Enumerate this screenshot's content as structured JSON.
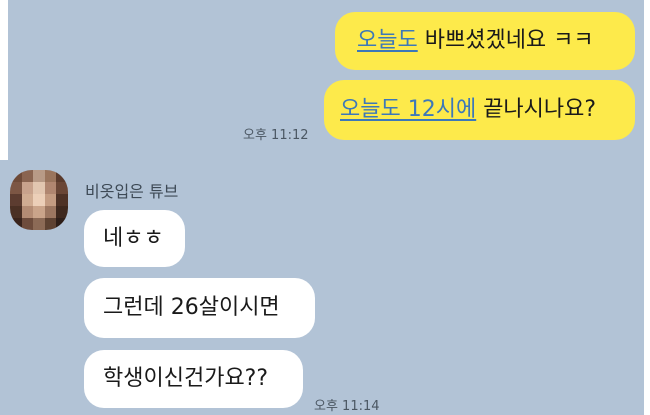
{
  "chat": {
    "sent": [
      {
        "link": "오늘도",
        "text": " 바쁘셨겠네요 ㅋㅋ"
      },
      {
        "link": "오늘도 12시에",
        "text": " 끝나시나요?"
      }
    ],
    "sent_time": "오후 11:12",
    "sender_name": "비옷입은 튜브",
    "received": [
      "네ㅎㅎ",
      "그런데 26살이시면",
      "학생이신건가요??"
    ],
    "received_time": "오후 11:14"
  },
  "colors": {
    "background": "#b2c3d6",
    "my_bubble": "#fdea4b",
    "their_bubble": "#ffffff",
    "link": "#3d78b8"
  },
  "avatar_blur": [
    "#6e4a38",
    "#8a6450",
    "#b89a86",
    "#9a745c",
    "#5a3a2c",
    "#7c5644",
    "#c8a28c",
    "#e2c6b0",
    "#b08670",
    "#6a4636",
    "#5c3c30",
    "#d0ac92",
    "#eccfb8",
    "#c49c82",
    "#4e3226",
    "#4a3024",
    "#b48c74",
    "#caa48a",
    "#9c7660",
    "#3e281e",
    "#3a241c",
    "#6e4c3c",
    "#8c6a56",
    "#5e4232",
    "#2e1e18"
  ]
}
